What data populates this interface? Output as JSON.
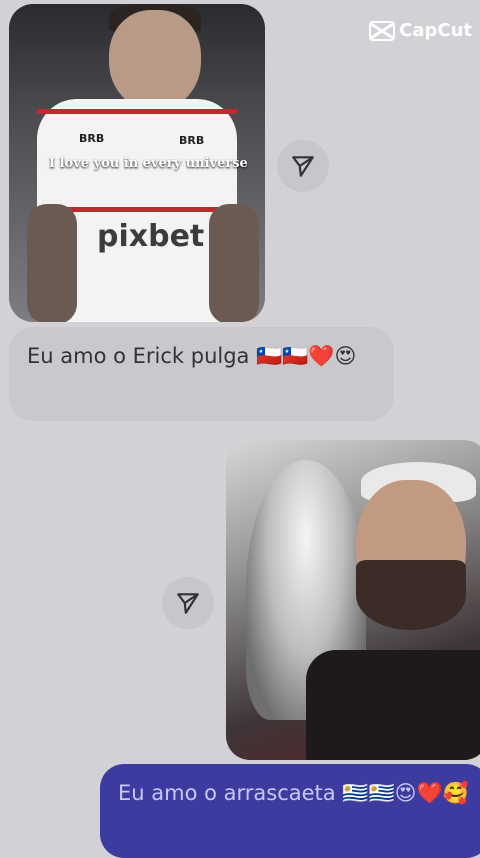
{
  "watermark": {
    "brand": "CapCut",
    "icon": "capcut-logo-icon"
  },
  "messages": [
    {
      "type": "image",
      "side": "left",
      "overlay_text": "I love you in every universe",
      "jersey_sponsors": [
        "BRB",
        "pixbet"
      ]
    },
    {
      "type": "text",
      "side": "left",
      "text": "Eu amo o Erick pulga 🇨🇱🇨🇱❤️😍"
    },
    {
      "type": "image",
      "side": "right"
    },
    {
      "type": "text",
      "side": "right",
      "text": "Eu amo o arrascaeta 🇺🇾🇺🇾😍❤️🥰"
    }
  ],
  "actions": {
    "send_icon": "send-arrow-icon"
  },
  "colors": {
    "background": "#d2d2d6",
    "incoming_bubble": "#c9c9cd",
    "outgoing_bubble": "#3c3ba0",
    "outgoing_text": "#c9c8f4"
  }
}
